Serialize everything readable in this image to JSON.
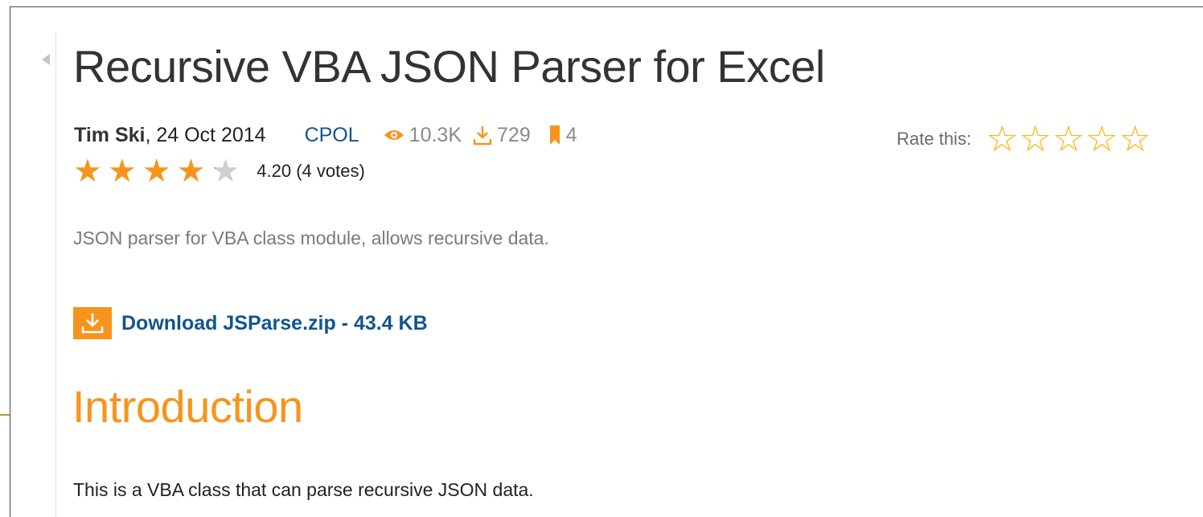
{
  "article": {
    "title": "Recursive VBA JSON Parser for Excel",
    "author": "Tim Ski",
    "date": ", 24 Oct 2014",
    "license": "CPOL",
    "views": "10.3K",
    "downloads": "729",
    "bookmarks": "4",
    "rating_text": "4.20 (4 votes)",
    "rating_value": 4.2,
    "rating_max": 5,
    "summary": "JSON parser for VBA class module, allows recursive data.",
    "download_label": "Download JSParse.zip - 43.4 KB"
  },
  "rate_widget": {
    "label": "Rate this:",
    "stars": 5
  },
  "content": {
    "intro_heading": "Introduction",
    "intro_text": "This is a VBA class that can parse recursive JSON data."
  },
  "icons": {
    "views": "eye-icon",
    "downloads": "download-icon",
    "bookmarks": "bookmark-icon",
    "download_file": "download-box-icon",
    "rating_star": "star-icon"
  },
  "colors": {
    "accent_orange": "#f7941d",
    "link_blue": "#10558f",
    "rate_star": "#fdb515",
    "empty_star": "#cfcfcf"
  }
}
